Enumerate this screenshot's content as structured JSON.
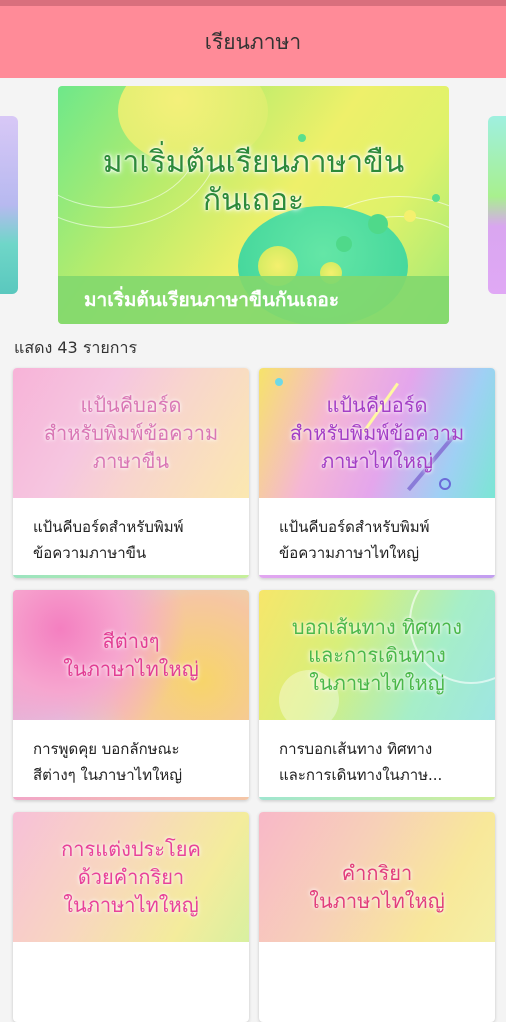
{
  "app_title": "เรียนภาษา",
  "banner": {
    "headline": "มาเริ่มต้นเรียนภาษาขืน\nกันเถอะ",
    "caption": "มาเริ่มต้นเรียนภาษาขืนกันเถอะ"
  },
  "list_count": "แสดง 43 รายการ",
  "cards": [
    {
      "thumb_text": "แป้นคีบอร์ด\nสำหรับพิมพ์ข้อความ\nภาษาขืน",
      "title": "แป้นคีบอร์ดสำหรับพิมพ์\nข้อความภาษาขืน"
    },
    {
      "thumb_text": "แป้นคีบอร์ด\nสำหรับพิมพ์ข้อความ\nภาษาไทใหญ่",
      "title": "แป้นคีบอร์ดสำหรับพิมพ์\nข้อความภาษาไทใหญ่"
    },
    {
      "thumb_text": "สีต่างๆ\nในภาษาไทใหญ่",
      "title": "การพูดคุย บอกลักษณะ\nสีต่างๆ ในภาษาไทใหญ่"
    },
    {
      "thumb_text": "บอกเส้นทาง ทิศทาง\nและการเดินทาง\nในภาษาไทใหญ่",
      "title": "การบอกเส้นทาง ทิศทาง\nและการเดินทางในภาษ..."
    },
    {
      "thumb_text": "การแต่งประโยค\nด้วยคำกริยา\nในภาษาไทใหญ่",
      "title": ""
    },
    {
      "thumb_text": "คำกริยา\nในภาษาไทใหญ่",
      "title": ""
    }
  ]
}
